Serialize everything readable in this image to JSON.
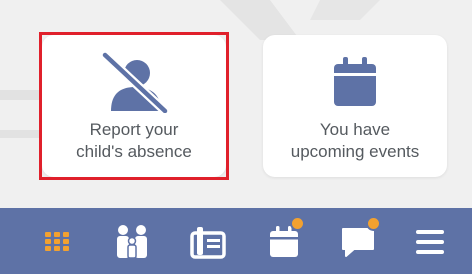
{
  "cards": {
    "absence": {
      "label_line1": "Report your",
      "label_line2": "child's absence",
      "icon": "person-off-icon"
    },
    "events": {
      "label_line1": "You have",
      "label_line2": "upcoming events",
      "icon": "calendar-icon"
    }
  },
  "navbar": {
    "items": [
      {
        "name": "apps-grid",
        "icon": "grid-icon",
        "color": "#f2a130"
      },
      {
        "name": "family",
        "icon": "family-icon"
      },
      {
        "name": "directory",
        "icon": "contact-book-icon"
      },
      {
        "name": "calendar",
        "icon": "calendar-icon",
        "badge": true
      },
      {
        "name": "messages",
        "icon": "chat-icon",
        "badge": true
      },
      {
        "name": "menu",
        "icon": "hamburger-icon"
      }
    ]
  },
  "colors": {
    "accent": "#5e72a6",
    "highlight": "#e0202b",
    "badge": "#f2a130",
    "text": "#555a5f"
  }
}
